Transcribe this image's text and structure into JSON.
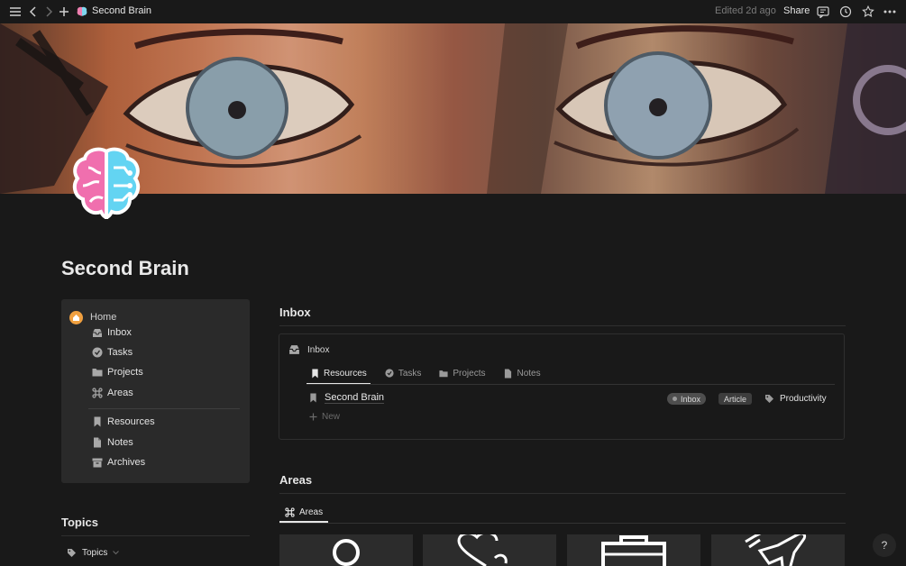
{
  "topbar": {
    "title": "Second Brain",
    "edited": "Edited 2d ago",
    "share": "Share"
  },
  "page": {
    "title": "Second Brain"
  },
  "sidebar": {
    "home": "Home",
    "items": [
      {
        "label": "Inbox",
        "icon": "inbox-icon"
      },
      {
        "label": "Tasks",
        "icon": "check-circle-icon"
      },
      {
        "label": "Projects",
        "icon": "folder-icon"
      },
      {
        "label": "Areas",
        "icon": "command-icon"
      },
      {
        "label": "Resources",
        "icon": "bookmark-icon"
      },
      {
        "label": "Notes",
        "icon": "document-icon"
      },
      {
        "label": "Archives",
        "icon": "archive-icon"
      }
    ]
  },
  "inbox": {
    "heading": "Inbox",
    "db_title": "Inbox",
    "tabs": [
      "Resources",
      "Tasks",
      "Projects",
      "Notes"
    ],
    "row": {
      "title": "Second Brain",
      "status": "Inbox",
      "type": "Article",
      "topic": "Productivity"
    },
    "new_label": "New"
  },
  "areas": {
    "heading": "Areas",
    "tab": "Areas"
  },
  "topics": {
    "heading": "Topics",
    "toggle": "Topics"
  },
  "help": "?"
}
